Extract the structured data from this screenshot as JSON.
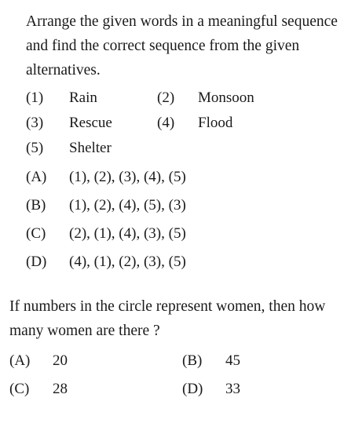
{
  "question1": {
    "prompt": "Arrange the given words in a meaningful sequence and find the correct sequence from the given alternatives.",
    "words": [
      {
        "num": "(1)",
        "word": "Rain"
      },
      {
        "num": "(2)",
        "word": "Monsoon"
      },
      {
        "num": "(3)",
        "word": "Rescue"
      },
      {
        "num": "(4)",
        "word": "Flood"
      },
      {
        "num": "(5)",
        "word": "Shelter"
      }
    ],
    "options": [
      {
        "letter": "(A)",
        "sequence": "(1), (2), (3), (4), (5)"
      },
      {
        "letter": "(B)",
        "sequence": "(1), (2), (4), (5), (3)"
      },
      {
        "letter": "(C)",
        "sequence": "(2), (1), (4), (3), (5)"
      },
      {
        "letter": "(D)",
        "sequence": "(4), (1), (2), (3), (5)"
      }
    ]
  },
  "question2": {
    "prompt": "If numbers in the circle represent women, then how many women are there ?",
    "options": [
      {
        "letter": "(A)",
        "value": "20"
      },
      {
        "letter": "(B)",
        "value": "45"
      },
      {
        "letter": "(C)",
        "value": "28"
      },
      {
        "letter": "(D)",
        "value": "33"
      }
    ]
  }
}
